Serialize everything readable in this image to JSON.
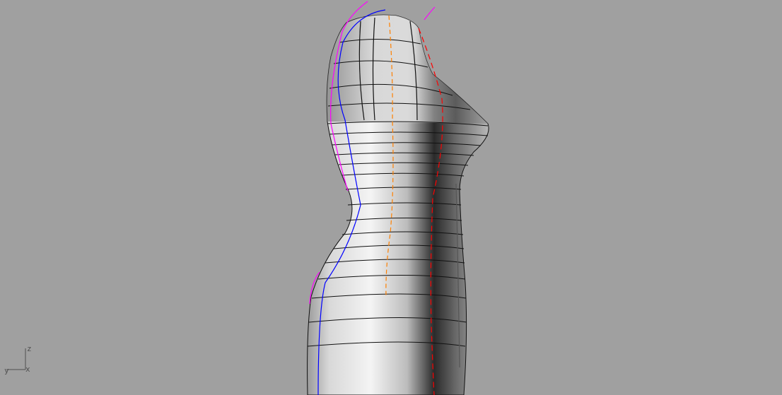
{
  "viewport": {
    "background": "#a0a0a0",
    "axes": {
      "z": "z",
      "y": "y",
      "x": "x"
    },
    "model": "mannequin-torso",
    "curve_colors": {
      "seam_front": "#ff8000",
      "seam_side": "#ff0000",
      "seam_back": "#0000ff",
      "edge": "#ff00ff"
    }
  }
}
